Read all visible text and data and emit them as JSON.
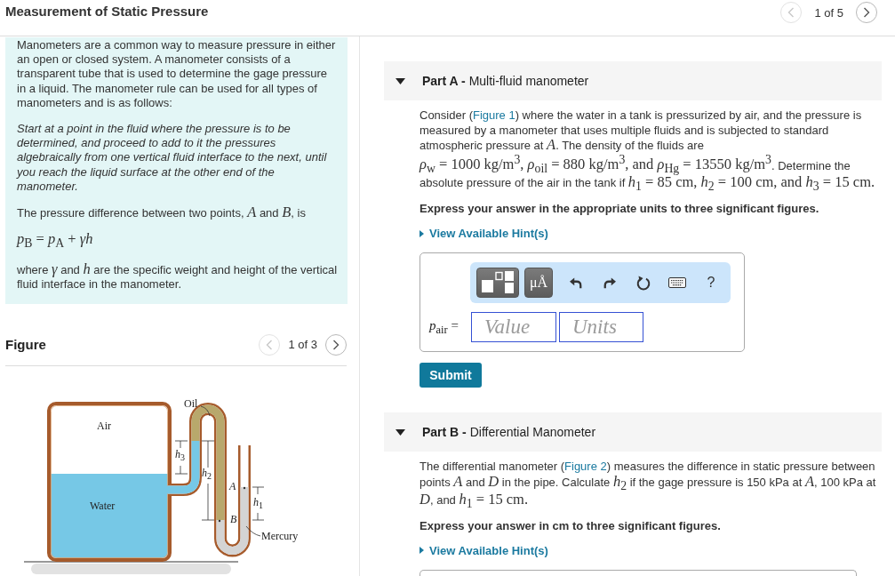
{
  "header": {
    "title": "Measurement of Static Pressure",
    "pager": {
      "label": "1 of 5",
      "prev_disabled": true,
      "next_disabled": false
    }
  },
  "intro": {
    "paragraphs": [
      {
        "kind": "text",
        "segments": [
          {
            "kind": "text",
            "text": "Manometers are a common way to measure pressure in either an open or closed system. A manometer consists of a transparent tube that is used to determine the gage pressure in a liquid. The manometer rule can be used for all types of manometers and is as follows:"
          }
        ]
      },
      {
        "kind": "italic",
        "segments": [
          {
            "kind": "text",
            "text": "Start at a point in the fluid where the pressure is to be determined, and proceed to add to it the pressures algebraically from one vertical fluid interface to the next, until you reach the liquid surface at the other end of the manometer."
          }
        ]
      },
      {
        "kind": "text",
        "segments": [
          {
            "kind": "text",
            "text": "The pressure difference between two points, "
          },
          {
            "kind": "var",
            "text": "A"
          },
          {
            "kind": "text",
            "text": " and "
          },
          {
            "kind": "var",
            "text": "B"
          },
          {
            "kind": "text",
            "text": ", is"
          }
        ]
      },
      {
        "kind": "formula",
        "segments": [
          {
            "kind": "math",
            "text": "*p*$_{B}$ = *p*$_{A}$ + *γh*"
          }
        ]
      },
      {
        "kind": "text",
        "segments": [
          {
            "kind": "text",
            "text": "where "
          },
          {
            "kind": "var",
            "text": "γ"
          },
          {
            "kind": "text",
            "text": " and "
          },
          {
            "kind": "var",
            "text": "h"
          },
          {
            "kind": "text",
            "text": " are the specific weight and height of the vertical fluid interface in the manometer."
          }
        ]
      }
    ]
  },
  "figure": {
    "heading": "Figure",
    "pager": {
      "label": "1 of 3",
      "prev_disabled": true,
      "next_disabled": false
    },
    "labels": {
      "oil": "Oil",
      "air": "Air",
      "h3": "*h*$_{3}$",
      "h2": "*h*$_{2}$",
      "point_a": "A",
      "h1": "*h*$_{1}$",
      "water": "Water",
      "point_b": "B",
      "mercury": "Mercury"
    }
  },
  "parts": [
    {
      "title": "**Part A -** Multi-fluid manometer",
      "expanded": true,
      "statement": [
        {
          "kind": "text",
          "text": "Consider ("
        },
        {
          "kind": "link",
          "text": "Figure 1"
        },
        {
          "kind": "text",
          "text": ") where the water in a tank is pressurized by air, and the pressure is measured by a manometer that uses multiple fluids and is subjected to standard atmospheric pressure at "
        },
        {
          "kind": "var",
          "text": "A"
        },
        {
          "kind": "text",
          "text": ". The density of the fluids are "
        },
        {
          "kind": "math",
          "text": "*ρ*$_{w}$ = 1000 kg/m$^{3}$, *ρ*$_{oil}$ = 880 kg/m$^{3}$, and *ρ*$_{Hg}$ = 13550 kg/m$^{3}$"
        },
        {
          "kind": "text",
          "text": ". Determine the absolute pressure of the air in the tank if "
        },
        {
          "kind": "math",
          "text": "*h*$_{1}$ = 85 cm, *h*$_{2}$ = 100 cm, and *h*$_{3}$ = 15 cm."
        }
      ],
      "instruction": "Express your answer in the appropriate units to three significant figures.",
      "hint": {
        "label": "View Available Hint(s)",
        "expanded": false
      },
      "answer": {
        "toolbar": [
          {
            "kind": "template"
          },
          {
            "kind": "units",
            "label": "μÅ"
          },
          {
            "kind": "undo"
          },
          {
            "kind": "redo"
          },
          {
            "kind": "reset"
          },
          {
            "kind": "keyboard"
          },
          {
            "kind": "help",
            "label": "?"
          }
        ],
        "variable": "*p*$_{air}$ =",
        "value_field": {
          "placeholder": "Value"
        },
        "units_field": {
          "placeholder": "Units"
        },
        "submit": "Submit"
      }
    },
    {
      "title": "**Part B -** Differential Manometer",
      "expanded": true,
      "statement": [
        {
          "kind": "text",
          "text": "The differential manometer ("
        },
        {
          "kind": "link",
          "text": "Figure 2"
        },
        {
          "kind": "text",
          "text": ") measures the difference in static pressure between points "
        },
        {
          "kind": "var",
          "text": "A"
        },
        {
          "kind": "text",
          "text": " and "
        },
        {
          "kind": "var",
          "text": "D"
        },
        {
          "kind": "text",
          "text": " in the pipe. Calculate "
        },
        {
          "kind": "math",
          "text": "*h*$_{2}$"
        },
        {
          "kind": "text",
          "text": " if the gage pressure is 150 kPa at "
        },
        {
          "kind": "var",
          "text": "A"
        },
        {
          "kind": "text",
          "text": ", 100 kPa at "
        },
        {
          "kind": "var",
          "text": "D"
        },
        {
          "kind": "text",
          "text": ", and "
        },
        {
          "kind": "math",
          "text": "*h*$_{1}$ = 15 cm."
        }
      ],
      "instruction": "Express your answer in cm to three significant figures.",
      "hint": {
        "label": "View Available Hint(s)",
        "expanded": false
      }
    }
  ]
}
